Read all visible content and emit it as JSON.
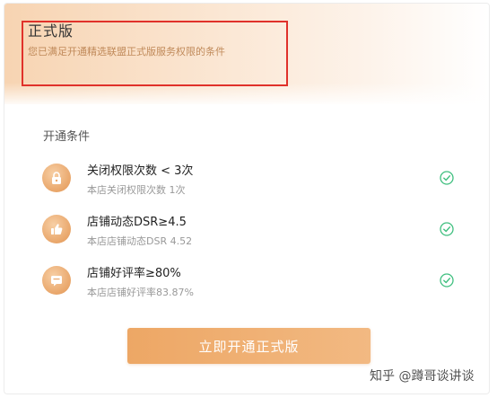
{
  "header": {
    "title": "正式版",
    "subtitle": "您已满足开通精选联盟正式版服务权限的条件"
  },
  "conditions": {
    "label": "开通条件",
    "items": [
      {
        "icon": "lock-icon",
        "title": "关闭权限次数 < 3次",
        "sub": "本店关闭权限次数 1次",
        "status": "met"
      },
      {
        "icon": "thumbs-up-icon",
        "title": "店铺动态DSR≥4.5",
        "sub": "本店店铺动态DSR 4.52",
        "status": "met"
      },
      {
        "icon": "message-icon",
        "title": "店铺好评率≥80%",
        "sub": "本店店铺好评率83.87%",
        "status": "met"
      }
    ]
  },
  "cta": {
    "label": "立即开通正式版"
  },
  "watermark": {
    "text": "知乎 @蹲哥谈讲谈"
  },
  "colors": {
    "accent": "#eda765",
    "check": "#3fbf7f",
    "highlight_border": "#e0312a"
  }
}
